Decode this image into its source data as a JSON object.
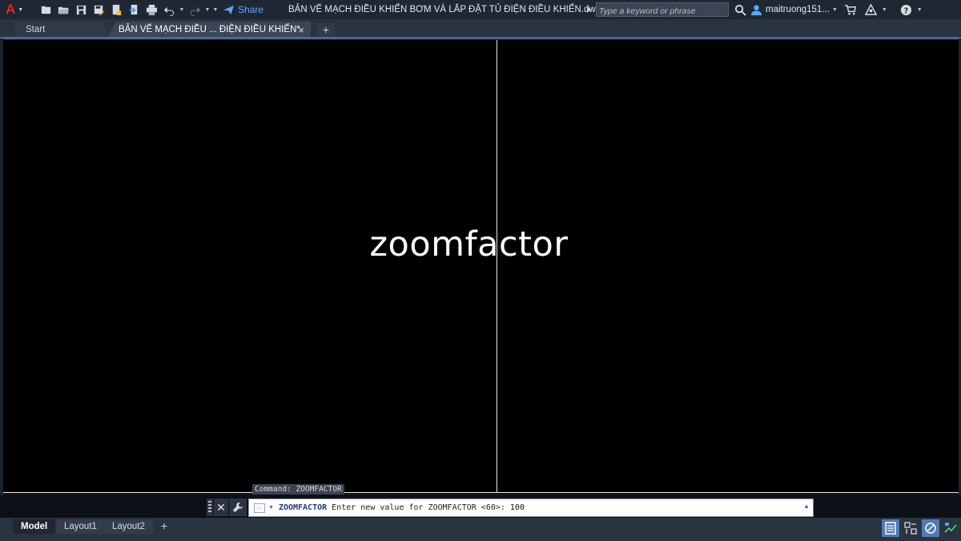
{
  "app": {
    "logo_letter": "A",
    "share_label": "Share",
    "document_title": "BẢN VẼ MẠCH ĐIỀU KHIỂN BƠM VÀ LẮP ĐẶT TỦ ĐIỆN ĐIỀU KHIỂN.dwg",
    "search_placeholder": "Type a keyword or phrase",
    "user_name": "maitruong151..."
  },
  "tabs": [
    {
      "label": "Start"
    },
    {
      "label": "BẢN VẼ MẠCH ĐIỀU ... ĐIỆN ĐIỀU KHIỂN*",
      "close": "×"
    }
  ],
  "tab_add": "+",
  "canvas": {
    "overlay_text": "zoomfactor"
  },
  "command": {
    "history": "Command: ZOOMFACTOR",
    "name": "ZOOMFACTOR",
    "prompt": "Enter new value for ZOOMFACTOR <60>:",
    "value": "100"
  },
  "layouts": [
    {
      "label": "Model",
      "active": true
    },
    {
      "label": "Layout1",
      "active": false
    },
    {
      "label": "Layout2",
      "active": false
    }
  ],
  "layout_add": "+",
  "icons": {
    "quick_access": [
      "new-icon",
      "open-icon",
      "save-icon",
      "save-as-icon",
      "publish-icon",
      "export-icon",
      "print-icon",
      "undo-icon",
      "redo-icon"
    ],
    "right": [
      "search-icon",
      "user-icon",
      "cart-icon",
      "autodesk-apps-icon",
      "help-icon"
    ],
    "status": [
      "model-space-icon",
      "grid-icon",
      "ortho-icon",
      "annotation-icon"
    ]
  },
  "colors": {
    "logo_red": "#e0281d",
    "share_blue": "#5aa8ff",
    "canvas_bg": "#000000",
    "accent": "#4f7ab3"
  }
}
